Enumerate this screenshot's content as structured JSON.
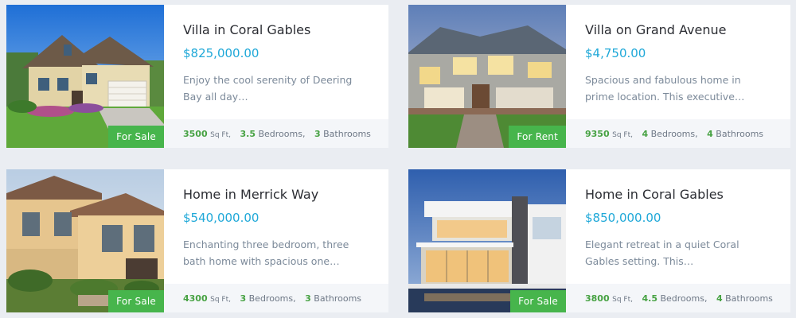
{
  "listings": [
    {
      "title": "Villa in Coral Gables",
      "price": "$825,000.00",
      "description": "Enjoy the cool serenity of Deering Bay all day…",
      "status": "For Sale",
      "sqft": "3500",
      "sqft_unit": "Sq Ft,",
      "bedrooms": "3.5",
      "bedrooms_label": "Bedrooms,",
      "bathrooms": "3",
      "bathrooms_label": "Bathrooms"
    },
    {
      "title": "Villa on Grand Avenue",
      "price": "$4,750.00",
      "description": "Spacious and fabulous home in prime location. This executive…",
      "status": "For Rent",
      "sqft": "9350",
      "sqft_unit": "Sq Ft,",
      "bedrooms": "4",
      "bedrooms_label": "Bedrooms,",
      "bathrooms": "4",
      "bathrooms_label": "Bathrooms"
    },
    {
      "title": "Home in Merrick Way",
      "price": "$540,000.00",
      "description": "Enchanting three bedroom, three bath home with spacious one…",
      "status": "For Sale",
      "sqft": "4300",
      "sqft_unit": "Sq Ft,",
      "bedrooms": "3",
      "bedrooms_label": "Bedrooms,",
      "bathrooms": "3",
      "bathrooms_label": "Bathrooms"
    },
    {
      "title": "Home in Coral Gables",
      "price": "$850,000.00",
      "description": "Elegant retreat in a quiet Coral Gables setting. This…",
      "status": "For Sale",
      "sqft": "3800",
      "sqft_unit": "Sq Ft,",
      "bedrooms": "4.5",
      "bedrooms_label": "Bedrooms,",
      "bathrooms": "4",
      "bathrooms_label": "Bathrooms"
    }
  ],
  "colors": {
    "page_background": "#eaedf2",
    "price": "#1fa8d8",
    "badge": "#47b54c",
    "stat_number": "#47a243",
    "description": "#7c8a9a"
  }
}
